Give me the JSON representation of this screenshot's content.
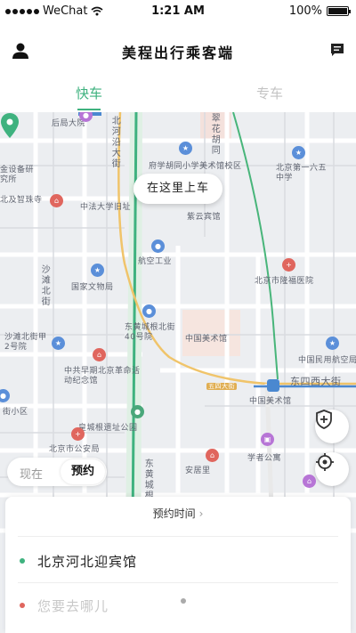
{
  "status_bar": {
    "carrier": "WeChat",
    "time": "1:21 AM",
    "battery": "100%"
  },
  "header": {
    "title": "美程出行乘客端",
    "left_icon": "person-icon",
    "right_icon": "message-icon"
  },
  "tabs": [
    {
      "label": "快车",
      "active": true
    },
    {
      "label": "专车",
      "active": false
    }
  ],
  "colors": {
    "accent": "#3fb27f",
    "inactive": "#c4c4c4",
    "destination_dot": "#e0665e"
  },
  "map": {
    "pickup_label": "在这里上车",
    "labels": [
      "后局大院",
      "北河沿大街",
      "东皇城根北街",
      "翠花胡同",
      "府学胡同小学美术馆校区",
      "北京第一六五中学",
      "金设备研究所",
      "北及智珠寺",
      "中法大学旧址",
      "紫云宾馆",
      "航空工业",
      "国家文物局",
      "北京市隆福医院",
      "沙滩北街",
      "东黄城根北街40号院",
      "中国美术馆",
      "沙滩北街甲2号院",
      "中共早期北京革命活动纪念馆",
      "中国民用航空局",
      "五四大街",
      "东四西大街",
      "中国美术馆",
      "街小区",
      "皇城根遗址公园",
      "北京市公安局",
      "学者公寓",
      "东黄城根",
      "安居里"
    ]
  },
  "fab": {
    "shield_icon": "shield-plus-icon",
    "locate_icon": "crosshair-icon"
  },
  "mode_toggle": {
    "now_label": "现在",
    "reserve_label": "预约",
    "selected": "预约"
  },
  "booking": {
    "reserve_time_label": "预约时间",
    "chevron": "›",
    "from": "北京河北迎宾馆",
    "to_placeholder": "您要去哪儿"
  }
}
